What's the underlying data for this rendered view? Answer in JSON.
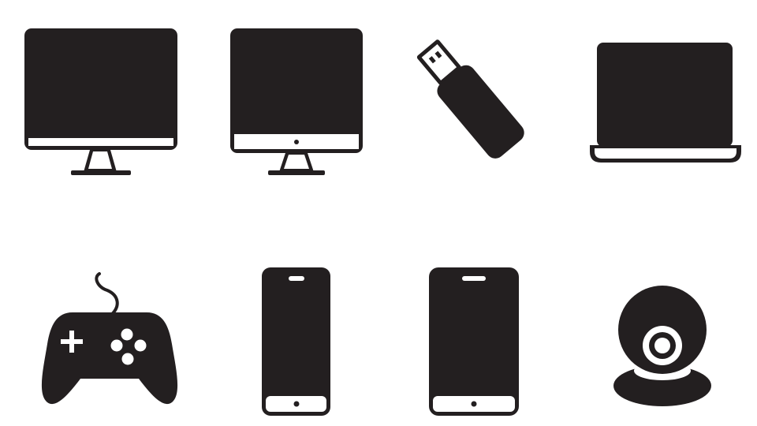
{
  "icon_set": {
    "background_color": "#ffffff",
    "icon_color": "#231f20",
    "rows": [
      {
        "icons": [
          {
            "name": "desktop-monitor-icon"
          },
          {
            "name": "imac-monitor-icon"
          },
          {
            "name": "usb-flash-drive-icon"
          },
          {
            "name": "laptop-icon"
          }
        ]
      },
      {
        "icons": [
          {
            "name": "gamepad-icon"
          },
          {
            "name": "smartphone-icon"
          },
          {
            "name": "tablet-phone-icon"
          },
          {
            "name": "webcam-icon"
          }
        ]
      }
    ]
  }
}
